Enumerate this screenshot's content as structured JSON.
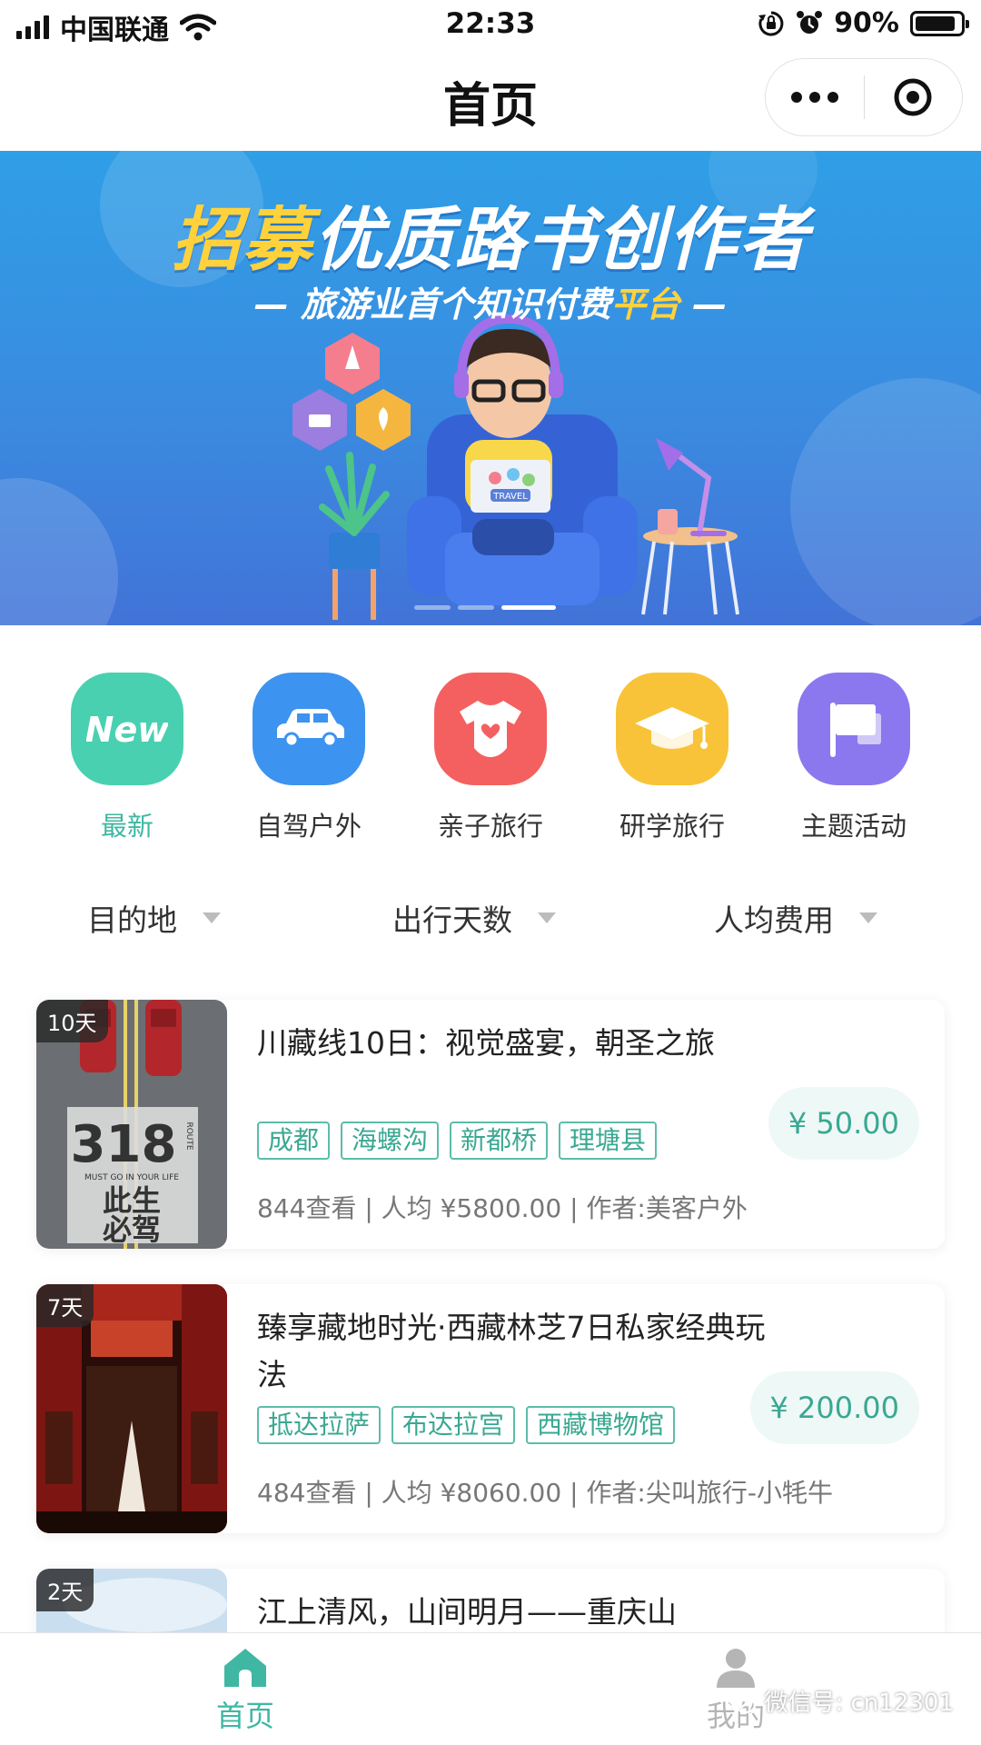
{
  "status_bar": {
    "carrier": "中国联通",
    "time": "22:33",
    "battery_percent": "90%",
    "battery_level": 0.9
  },
  "nav": {
    "title": "首页"
  },
  "banner": {
    "headline_part1": "招募",
    "headline_part2": "优质路书创作者",
    "sub_prefix": "— 旅游业首个知识付费",
    "sub_highlight": "平台",
    "sub_suffix": " —",
    "laptop_sticker": "TRAVEL",
    "slide_count": 3,
    "active_slide": 3
  },
  "categories": [
    {
      "label": "最新",
      "icon": "new-badge-icon",
      "color": "#49d0b0",
      "icon_text": "New",
      "active": true
    },
    {
      "label": "自驾户外",
      "icon": "car-icon",
      "color": "#3d93f0",
      "active": false
    },
    {
      "label": "亲子旅行",
      "icon": "baby-onesie-icon",
      "color": "#f4605f",
      "active": false
    },
    {
      "label": "研学旅行",
      "icon": "graduation-cap-icon",
      "color": "#f8c338",
      "active": false
    },
    {
      "label": "主题活动",
      "icon": "flag-icon",
      "color": "#8b78ee",
      "active": false
    }
  ],
  "filters": [
    {
      "label": "目的地"
    },
    {
      "label": "出行天数"
    },
    {
      "label": "人均费用"
    }
  ],
  "trips": [
    {
      "days": "10天",
      "title": "川藏线10日：视觉盛宴，朝圣之旅",
      "tags": [
        "成都",
        "海螺沟",
        "新都桥",
        "理塘县"
      ],
      "price": "¥ 50.00",
      "meta": "844查看 | 人均 ¥5800.00 | 作者:美客户外",
      "thumb_big": "318",
      "thumb_route": "ROUTE",
      "thumb_caption": "MUST GO IN YOUR LIFE",
      "thumb_slogan_1": "此生",
      "thumb_slogan_2": "必驾"
    },
    {
      "days": "7天",
      "title": "臻享藏地时光·西藏林芝7日私家经典玩法",
      "tags": [
        "抵达拉萨",
        "布达拉宫",
        "西藏博物馆"
      ],
      "price": "¥ 200.00",
      "meta": "484查看 | 人均 ¥8060.00 | 作者:尖叫旅行-小牦牛"
    },
    {
      "days": "2天",
      "title": "江上清风，山间明月——重庆山"
    }
  ],
  "tab_bar": {
    "home_label": "首页",
    "mine_label": "我的"
  },
  "watermark": "微信号: cn12301"
}
